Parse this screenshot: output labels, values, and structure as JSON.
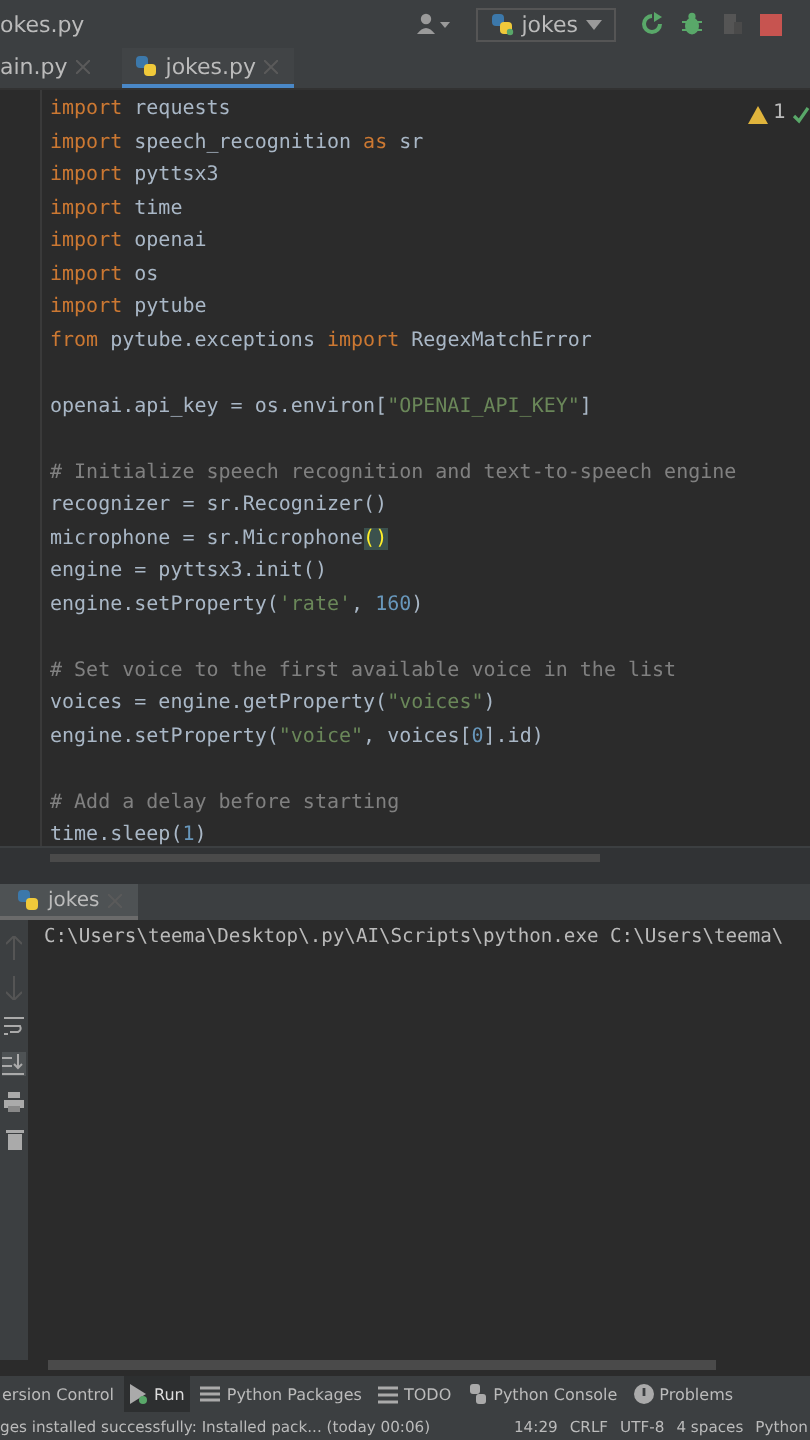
{
  "title_bar": {
    "file": "okes.py",
    "run_config": "jokes"
  },
  "editor_tabs": [
    {
      "label": "ain.py",
      "selected": false
    },
    {
      "label": "jokes.py",
      "selected": true
    }
  ],
  "inspections": {
    "warnings": "1"
  },
  "code_lines": [
    {
      "kind": "code",
      "tokens": [
        {
          "kind": "keyword",
          "text": "import"
        },
        {
          "kind": "plain",
          "text": " requests"
        }
      ]
    },
    {
      "kind": "code",
      "tokens": [
        {
          "kind": "keyword",
          "text": "import"
        },
        {
          "kind": "plain",
          "text": " speech_recognition "
        },
        {
          "kind": "keyword",
          "text": "as"
        },
        {
          "kind": "plain",
          "text": " sr"
        }
      ]
    },
    {
      "kind": "code",
      "tokens": [
        {
          "kind": "keyword",
          "text": "import"
        },
        {
          "kind": "plain",
          "text": " pyttsx3"
        }
      ]
    },
    {
      "kind": "code",
      "tokens": [
        {
          "kind": "keyword",
          "text": "import"
        },
        {
          "kind": "plain",
          "text": " time"
        }
      ]
    },
    {
      "kind": "code",
      "tokens": [
        {
          "kind": "keyword",
          "text": "import"
        },
        {
          "kind": "plain",
          "text": " openai"
        }
      ]
    },
    {
      "kind": "code",
      "tokens": [
        {
          "kind": "keyword",
          "text": "import"
        },
        {
          "kind": "plain",
          "text": " os"
        }
      ]
    },
    {
      "kind": "code",
      "tokens": [
        {
          "kind": "keyword",
          "text": "import"
        },
        {
          "kind": "plain",
          "text": " pytube"
        }
      ]
    },
    {
      "kind": "code",
      "tokens": [
        {
          "kind": "keyword",
          "text": "from"
        },
        {
          "kind": "plain",
          "text": " pytube.exceptions "
        },
        {
          "kind": "keyword",
          "text": "import"
        },
        {
          "kind": "plain",
          "text": " RegexMatchError"
        }
      ]
    },
    {
      "kind": "blank"
    },
    {
      "kind": "code",
      "tokens": [
        {
          "kind": "plain",
          "text": "openai.api_key = os.environ["
        },
        {
          "kind": "string",
          "text": "\"OPENAI_API_KEY\""
        },
        {
          "kind": "plain",
          "text": "]"
        }
      ]
    },
    {
      "kind": "blank"
    },
    {
      "kind": "code",
      "tokens": [
        {
          "kind": "comment",
          "text": "# Initialize speech recognition and text-to-speech engine"
        }
      ]
    },
    {
      "kind": "code",
      "tokens": [
        {
          "kind": "plain",
          "text": "recognizer = sr.Recognizer()"
        }
      ]
    },
    {
      "kind": "code",
      "tokens": [
        {
          "kind": "plain",
          "text": "microphone = sr.Microphone"
        },
        {
          "kind": "match",
          "text": "()"
        }
      ]
    },
    {
      "kind": "code",
      "tokens": [
        {
          "kind": "plain",
          "text": "engine = pyttsx3.init()"
        }
      ]
    },
    {
      "kind": "code",
      "tokens": [
        {
          "kind": "plain",
          "text": "engine.setProperty("
        },
        {
          "kind": "string",
          "text": "'rate'"
        },
        {
          "kind": "plain",
          "text": ", "
        },
        {
          "kind": "number",
          "text": "160"
        },
        {
          "kind": "plain",
          "text": ")"
        }
      ]
    },
    {
      "kind": "blank"
    },
    {
      "kind": "code",
      "tokens": [
        {
          "kind": "comment",
          "text": "# Set voice to the first available voice in the list"
        }
      ]
    },
    {
      "kind": "code",
      "tokens": [
        {
          "kind": "plain",
          "text": "voices = engine.getProperty("
        },
        {
          "kind": "string",
          "text": "\"voices\""
        },
        {
          "kind": "plain",
          "text": ")"
        }
      ]
    },
    {
      "kind": "code",
      "tokens": [
        {
          "kind": "plain",
          "text": "engine.setProperty("
        },
        {
          "kind": "string",
          "text": "\"voice\""
        },
        {
          "kind": "plain",
          "text": ", voices["
        },
        {
          "kind": "number",
          "text": "0"
        },
        {
          "kind": "plain",
          "text": "].id)"
        }
      ]
    },
    {
      "kind": "blank"
    },
    {
      "kind": "code",
      "tokens": [
        {
          "kind": "comment",
          "text": "# Add a delay before starting"
        }
      ]
    },
    {
      "kind": "code",
      "tokens": [
        {
          "kind": "plain",
          "text": "time.sleep("
        },
        {
          "kind": "number",
          "text": "1"
        },
        {
          "kind": "plain",
          "text": ")"
        }
      ]
    }
  ],
  "run_panel": {
    "tab": "jokes",
    "output": "C:\\Users\\teema\\Desktop\\.py\\AI\\Scripts\\python.exe C:\\Users\\teema\\"
  },
  "tool_tabs": [
    {
      "label": "ersion Control",
      "kind": "vcs",
      "selected": false
    },
    {
      "label": "Run",
      "kind": "run",
      "selected": true
    },
    {
      "label": "Python Packages",
      "kind": "packages",
      "selected": false
    },
    {
      "label": "TODO",
      "kind": "todo",
      "selected": false
    },
    {
      "label": "Python Console",
      "kind": "console",
      "selected": false
    },
    {
      "label": "Problems",
      "kind": "problems",
      "selected": false
    }
  ],
  "status_bar": {
    "message": "ges installed successfully: Installed pack... (today 00:06)",
    "items": [
      "14:29",
      "CRLF",
      "UTF-8",
      "4 spaces",
      "Python"
    ]
  }
}
